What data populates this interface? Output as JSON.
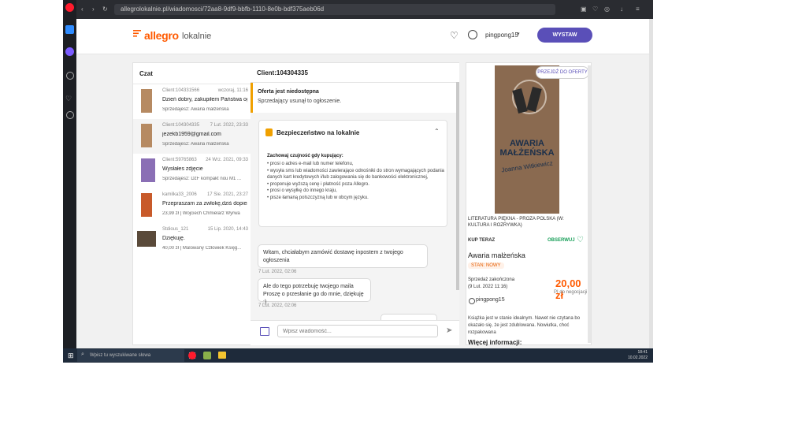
{
  "browser": {
    "url": "allegrolokalnie.pl/wiadomosci/72aa8-9df9-bbfb-1110-8e0b-bdf375aeb06d"
  },
  "site": {
    "logo": "allegro",
    "logo_suffix": "lokalnie",
    "username": "pingpong15",
    "cta_label": "WYSTAW",
    "brand_color": "#ff5a00",
    "accent_color": "#5a4fb8"
  },
  "chat_list": {
    "title": "Czat",
    "items": [
      {
        "name": "Client:104331566",
        "date": "wczoraj, 11:16",
        "message": "Dzień dobry, zakupiłem Państwa ogł...",
        "seller": "Sprzedajesz: Awaria małżeńska"
      },
      {
        "name": "Client:104304335",
        "date": "7 Lut. 2022, 23:33",
        "message": "jezekb1959@gmail.com",
        "seller": "Sprzedajesz: Awaria małżeńska"
      },
      {
        "name": "Client:59765863",
        "date": "24 Wrz. 2021, 09:33",
        "message": "Wysłałes zdjęcie",
        "seller": "Sprzedajesz: DzF kompakt nou M1 ..."
      },
      {
        "name": "kamilka33_2006",
        "date": "17 Sie. 2021, 23:27",
        "message": "Przepraszam za zwłokę,dziś dopiero ...",
        "seller": "23,99 zł | Wojciech Chmielarz Wyrwa"
      },
      {
        "name": "Stdious_121",
        "date": "15 Lip. 2020, 14:43",
        "message": "Dziękuję.",
        "seller": "40,00 zł | Malowany Człowiek Księg..."
      }
    ]
  },
  "conversation": {
    "title": "Client:104304335",
    "notice_title": "Oferta jest niedostępna",
    "notice_text": "Sprzedający usunął to ogłoszenie.",
    "safety_title": "Bezpieczeństwo na lokalnie",
    "safety_intro": "Zachowaj czujność gdy kupujący:",
    "safety_points": [
      "prosi o adres e-mail lub numer telefonu,",
      "wysyła sms lub wiadomości zawierające odnośniki do stron wymagających podania danych kart kredytowych i/lub zalogowania się do bankowości elektronicznej,",
      "proponuje wyższą cenę i płatność poza Allegro.",
      "prosi o wysyłkę do innego kraju,",
      "pisze łamaną polszczyzną lub w obcym języku."
    ],
    "messages": [
      {
        "text": "Witam, chciałabym zamówić dostawę inpostem z twojego ogłoszenia",
        "time": "7 Lut. 2022, 02:06"
      },
      {
        "text": "Ale do tego potrzebuję twojego maila Proszę o przesłanie go do mnie, dziękuję :)",
        "time": "7 Lut. 2022, 02:06"
      }
    ],
    "input_placeholder": "Wpisz wiadomość..."
  },
  "offer": {
    "go_to_offer": "PRZEJDŹ DO OFERTY",
    "cover_title": "AWARIA MAŁŻEŃSKA",
    "cover_author": "Joanna Witkiewicz",
    "category": "LITERATURA PIĘKNA - PROZA POLSKA (W: KULTURA I ROZRYWKA)",
    "type": "KUP TERAZ",
    "follow": "OBSERWUJ",
    "title": "Awaria małżeńska",
    "condition": "STAN: NOWY",
    "ended_label": "Sprzedaż zakończona",
    "ended_date": "(9 Lut. 2022 11:16)",
    "price": "20,00 zł",
    "negotiable": "PI do negocjacji",
    "seller": "pingpong15",
    "description": "Książka jest w stanie idealnym. Nawet nie czytana bo okazało się, że jest zdublowana. Nowiutka, choć rozpakowana",
    "more_info": "Więcej informacji:"
  },
  "taskbar": {
    "search_placeholder": "Wpisz tu wyszukiwane słowa",
    "time": "18:41",
    "date": "10.02.2022"
  }
}
